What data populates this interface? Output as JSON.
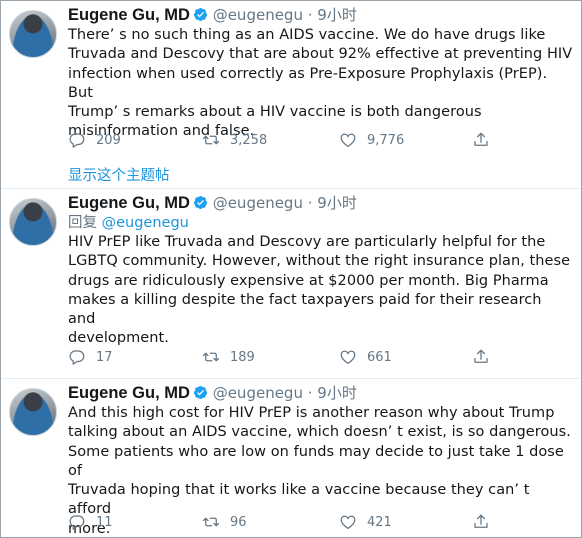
{
  "tweets": [
    {
      "author": {
        "name": "Eugene Gu, MD",
        "handle": "@eugenegu",
        "verified": true
      },
      "separator": "·",
      "time": "9小时",
      "reply_prefix": "",
      "reply_mention": "",
      "text": "There’ s no such thing as an AIDS vaccine. We do have drugs like\nTruvada and Descovy that are about 92% effective at preventing HIV\ninfection when used correctly as Pre-Exposure Prophylaxis (PrEP). But\nTrump’ s remarks about a HIV vaccine is both dangerous\nmisinformation and false.",
      "replies": "209",
      "retweets": "3,258",
      "likes": "9,776",
      "show_thread": "显示这个主题帖"
    },
    {
      "author": {
        "name": "Eugene Gu, MD",
        "handle": "@eugenegu",
        "verified": true
      },
      "separator": "·",
      "time": "9小时",
      "reply_prefix": "回复",
      "reply_mention": "@eugenegu",
      "text": "HIV PrEP like Truvada and Descovy are particularly helpful for the\nLGBTQ community. However, without the right insurance plan, these\ndrugs are ridiculously expensive at $2000 per month. Big Pharma\nmakes a killing despite the fact taxpayers paid for their research and\ndevelopment.",
      "replies": "17",
      "retweets": "189",
      "likes": "661"
    },
    {
      "author": {
        "name": "Eugene Gu, MD",
        "handle": "@eugenegu",
        "verified": true
      },
      "separator": "·",
      "time": "9小时",
      "reply_prefix": "",
      "reply_mention": "",
      "text": "And this high cost for HIV PrEP is another reason why about Trump\ntalking about an AIDS vaccine, which doesn’ t exist, is so dangerous.\nSome patients who are low on funds may decide to just take 1 dose of\nTruvada hoping that it works like a vaccine because they can’ t afford\nmore.",
      "replies": "11",
      "retweets": "96",
      "likes": "421"
    }
  ],
  "icons": {
    "reply": "reply-icon",
    "retweet": "retweet-icon",
    "like": "like-icon",
    "share": "share-icon",
    "verified": "verified-badge-icon"
  },
  "colors": {
    "link": "#1b95e0",
    "muted": "#657786",
    "text": "#14171a",
    "verified": "#1da1f2"
  }
}
